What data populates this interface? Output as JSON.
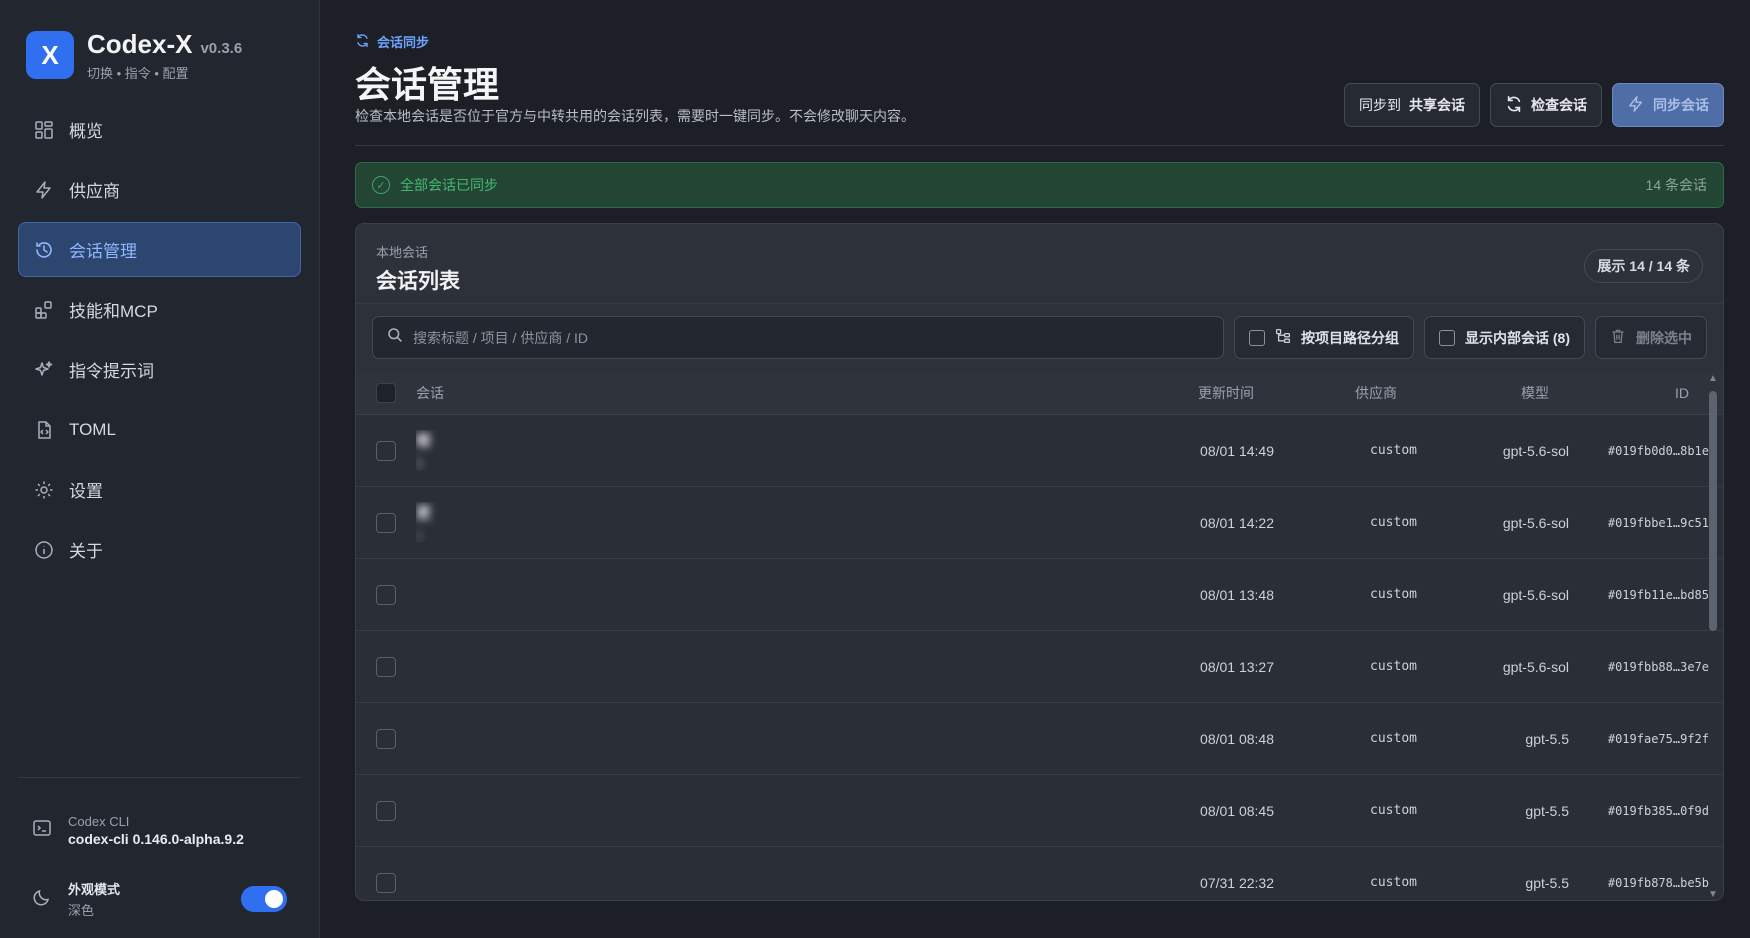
{
  "brand": {
    "logo": "X",
    "name": "Codex-X",
    "version": "v0.3.6",
    "subtitle": "切换 • 指令 • 配置"
  },
  "sidebar": {
    "items": [
      {
        "label": "概览",
        "icon": "grid-icon"
      },
      {
        "label": "供应商",
        "icon": "bolt-icon"
      },
      {
        "label": "会话管理",
        "icon": "history-icon",
        "active": true
      },
      {
        "label": "技能和MCP",
        "icon": "blocks-icon"
      },
      {
        "label": "指令提示词",
        "icon": "sparkles-icon"
      },
      {
        "label": "TOML",
        "icon": "file-code-icon"
      },
      {
        "label": "设置",
        "icon": "gear-icon"
      },
      {
        "label": "关于",
        "icon": "info-icon"
      }
    ],
    "cli": {
      "title": "Codex CLI",
      "version": "codex-cli 0.146.0-alpha.9.2"
    },
    "theme": {
      "title": "外观模式",
      "value": "深色",
      "enabled": true
    }
  },
  "header": {
    "crumb": "会话同步",
    "title": "会话管理",
    "description": "检查本地会话是否位于官方与中转共用的会话列表，需要时一键同步。不会修改聊天内容。",
    "sync_to_prefix": "同步到",
    "sync_to_target": "共享会话",
    "check_label": "检查会话",
    "sync_label": "同步会话"
  },
  "banner": {
    "text": "全部会话已同步",
    "count": "14 条会话"
  },
  "card": {
    "subtitle": "本地会话",
    "title": "会话列表",
    "badge": "展示 14 / 14 条",
    "search_placeholder": "搜索标题 / 项目 / 供应商 / ID",
    "group_label": "按项目路径分组",
    "internal_label": "显示内部会话 (8)",
    "delete_label": "删除选中"
  },
  "table": {
    "headers": {
      "session": "会话",
      "updated": "更新时间",
      "provider": "供应商",
      "model": "模型",
      "id": "ID"
    },
    "rows": [
      {
        "title": "帮",
        "path": "D",
        "time": "08/01 14:49",
        "provider": "custom",
        "model": "gpt-5.6-sol",
        "id": "#019fb0d0…8b1e"
      },
      {
        "title": "更",
        "path": "C",
        "time": "08/01 14:22",
        "provider": "custom",
        "model": "gpt-5.6-sol",
        "id": "#019fbbe1…9c51"
      },
      {
        "title": "",
        "path": "",
        "time": "08/01 13:48",
        "provider": "custom",
        "model": "gpt-5.6-sol",
        "id": "#019fb11e…bd85"
      },
      {
        "title": "",
        "path": "",
        "time": "08/01 13:27",
        "provider": "custom",
        "model": "gpt-5.6-sol",
        "id": "#019fbb88…3e7e"
      },
      {
        "title": "",
        "path": "",
        "time": "08/01 08:48",
        "provider": "custom",
        "model": "gpt-5.5",
        "id": "#019fae75…9f2f"
      },
      {
        "title": "",
        "path": "",
        "time": "08/01 08:45",
        "provider": "custom",
        "model": "gpt-5.5",
        "id": "#019fb385…0f9d"
      },
      {
        "title": "",
        "path": "",
        "time": "07/31 22:32",
        "provider": "custom",
        "model": "gpt-5.5",
        "id": "#019fb878…be5b"
      }
    ]
  },
  "colors": {
    "accent": "#2f6ff0",
    "success": "#47b774",
    "sidebar_active": "#2c4670"
  }
}
